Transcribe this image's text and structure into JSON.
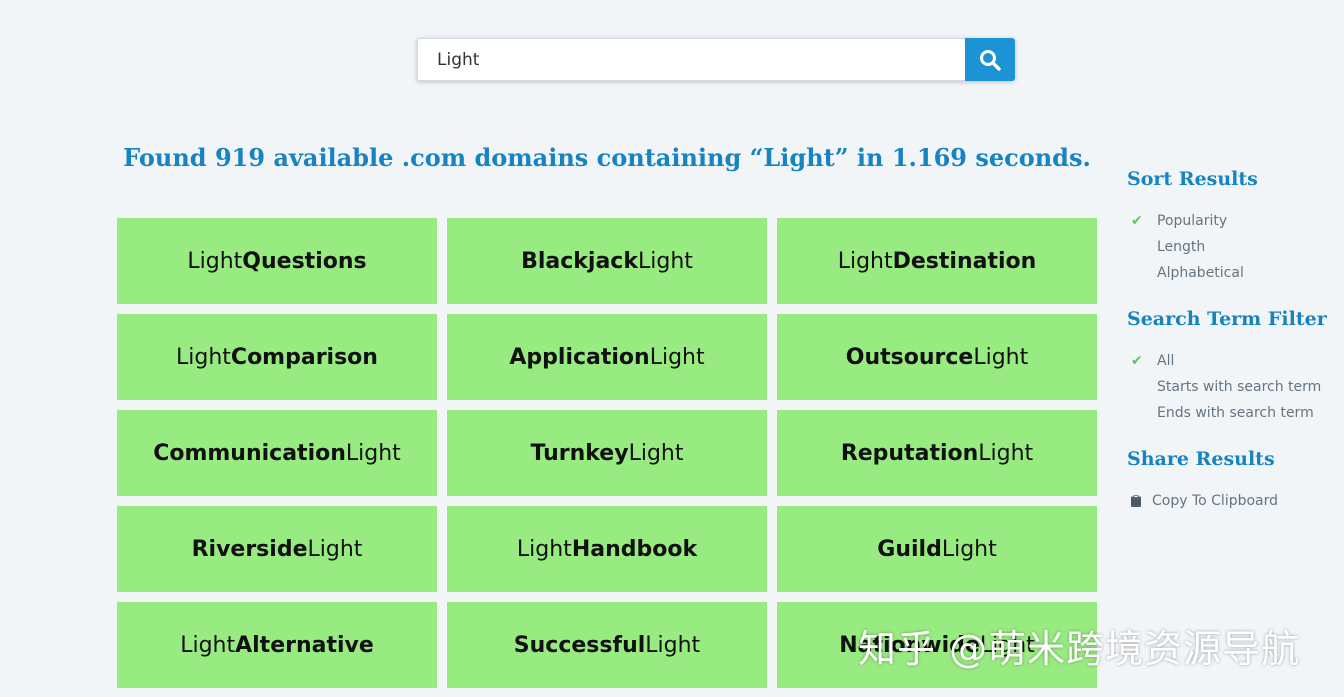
{
  "search": {
    "value": "Light"
  },
  "headline": "Found 919 available .com domains containing “Light” in 1.169 seconds.",
  "results": [
    {
      "prefix": "Light",
      "word": "Questions",
      "suffix": ""
    },
    {
      "prefix": "",
      "word": "Blackjack",
      "suffix": "Light"
    },
    {
      "prefix": "Light",
      "word": "Destination",
      "suffix": ""
    },
    {
      "prefix": "Light",
      "word": "Comparison",
      "suffix": ""
    },
    {
      "prefix": "",
      "word": "Application",
      "suffix": "Light"
    },
    {
      "prefix": "",
      "word": "Outsource",
      "suffix": "Light"
    },
    {
      "prefix": "",
      "word": "Communication",
      "suffix": "Light"
    },
    {
      "prefix": "",
      "word": "Turnkey",
      "suffix": "Light"
    },
    {
      "prefix": "",
      "word": "Reputation",
      "suffix": "Light"
    },
    {
      "prefix": "",
      "word": "Riverside",
      "suffix": "Light"
    },
    {
      "prefix": "Light",
      "word": "Handbook",
      "suffix": ""
    },
    {
      "prefix": "",
      "word": "Guild",
      "suffix": "Light"
    },
    {
      "prefix": "Light",
      "word": "Alternative",
      "suffix": ""
    },
    {
      "prefix": "",
      "word": "Successful",
      "suffix": "Light"
    },
    {
      "prefix": "",
      "word": "Nationwide",
      "suffix": "Light"
    }
  ],
  "sidebar": {
    "sort": {
      "title": "Sort Results",
      "options": [
        {
          "label": "Popularity",
          "selected": true
        },
        {
          "label": "Length",
          "selected": false
        },
        {
          "label": "Alphabetical",
          "selected": false
        }
      ]
    },
    "filter": {
      "title": "Search Term Filter",
      "options": [
        {
          "label": "All",
          "selected": true
        },
        {
          "label": "Starts with search term",
          "selected": false
        },
        {
          "label": "Ends with search term",
          "selected": false
        }
      ]
    },
    "share": {
      "title": "Share Results",
      "copy_label": "Copy To Clipboard"
    }
  },
  "watermark": "知乎 @萌米跨境资源导航",
  "colors": {
    "accent": "#1783c0",
    "button": "#1c93d4",
    "tile": "#98eb80",
    "check": "#5bc85a"
  }
}
